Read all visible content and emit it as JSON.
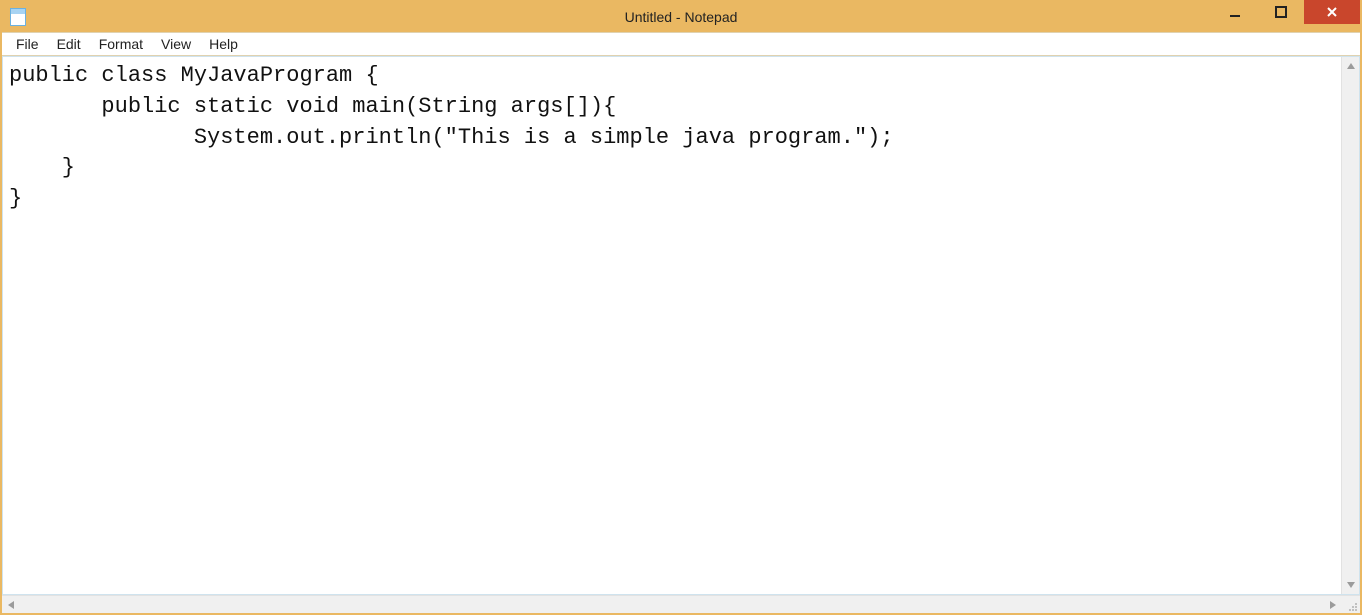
{
  "window": {
    "title": "Untitled - Notepad"
  },
  "menu": {
    "file": "File",
    "edit": "Edit",
    "format": "Format",
    "view": "View",
    "help": "Help"
  },
  "editor": {
    "content": "public class MyJavaProgram {\n       public static void main(String args[]){\n              System.out.println(\"This is a simple java program.\");\n    }\n}\n"
  }
}
